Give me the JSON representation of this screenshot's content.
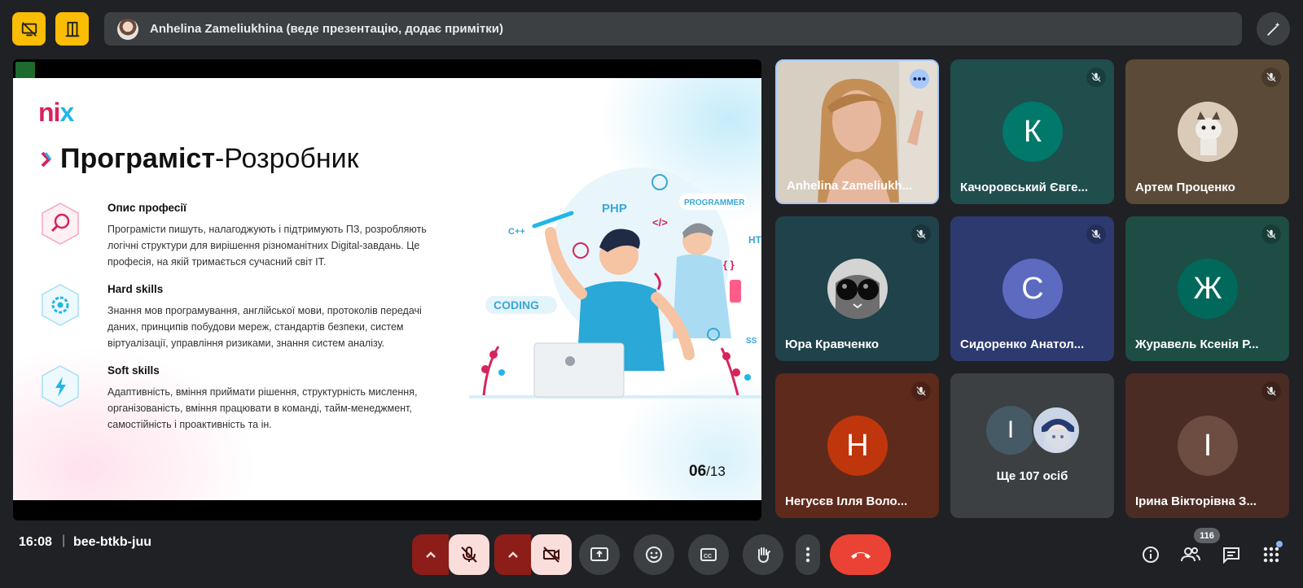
{
  "header": {
    "presenter_text": "Anhelina Zameliukhina (веде презентацію, додає примітки)"
  },
  "slide": {
    "logo_main": "ni",
    "logo_accent": "x",
    "title_bold": "Програміст",
    "title_rest": "-Розробник",
    "sections": [
      {
        "heading": "Опис професії",
        "text": "Програмісти пишуть, налагоджують і підтримують ПЗ, розробляють логічні структури для вирішення різноманітних Digital-завдань. Це професія, на якій тримається сучасний світ IT."
      },
      {
        "heading": "Hard skills",
        "text": "Знання мов програмування, англійської мови, протоколів передачі даних, принципів побудови мереж, стандартів безпеки, систем віртуалізації, управління ризиками, знання систем аналізу."
      },
      {
        "heading": "Soft skills",
        "text": "Адаптивність, вміння приймати рішення, структурність мислення, організованість, вміння працювати в команді, тайм-менеджмент, самостійність і проактивність та ін."
      }
    ],
    "illustration_labels": {
      "php": "PHP",
      "programmer": "PROGRAMMER",
      "cpp": "C++",
      "coding": "CODING",
      "html": "HT",
      "css": "SS",
      "tag": "</>",
      "braces": "{ }"
    },
    "page_current": "06",
    "page_total": "/13"
  },
  "participants": [
    {
      "name": "Anhelina Zameliukh...",
      "type": "video"
    },
    {
      "name": "Качоровський Євге...",
      "initial": "К",
      "avatar_color": "#00796b",
      "bg": "#1f4e4d"
    },
    {
      "name": "Артем Проценко",
      "type": "image",
      "bg": "#5a4a37"
    },
    {
      "name": "Юра Кравченко",
      "type": "image",
      "bg": "#20424a"
    },
    {
      "name": "Сидоренко Анатол...",
      "initial": "С",
      "avatar_color": "#5c6bc0",
      "bg": "#2c3a70"
    },
    {
      "name": "Журавель Ксенія Р...",
      "initial": "Ж",
      "avatar_color": "#00695c",
      "bg": "#1e4d45"
    },
    {
      "name": "Негусєв Ілля Воло...",
      "initial": "Н",
      "avatar_color": "#bf360c",
      "bg": "#5e2a1c"
    },
    {
      "name": "Ще 107 осіб",
      "initial": "І",
      "avatar_color": "#455a64",
      "bg": "#3c4043"
    },
    {
      "name": "Ірина Вікторівна З...",
      "initial": "І",
      "avatar_color": "#6d4c41",
      "bg": "#4a2c24"
    }
  ],
  "footer": {
    "time": "16:08",
    "separator": "|",
    "meeting_code": "bee-btkb-juu",
    "participant_count": "116"
  },
  "colors": {
    "warning_yellow": "#fbbc04",
    "end_call_red": "#ea4335",
    "muted_pink": "#f9dedc",
    "muted_dark": "#8c1d18"
  }
}
